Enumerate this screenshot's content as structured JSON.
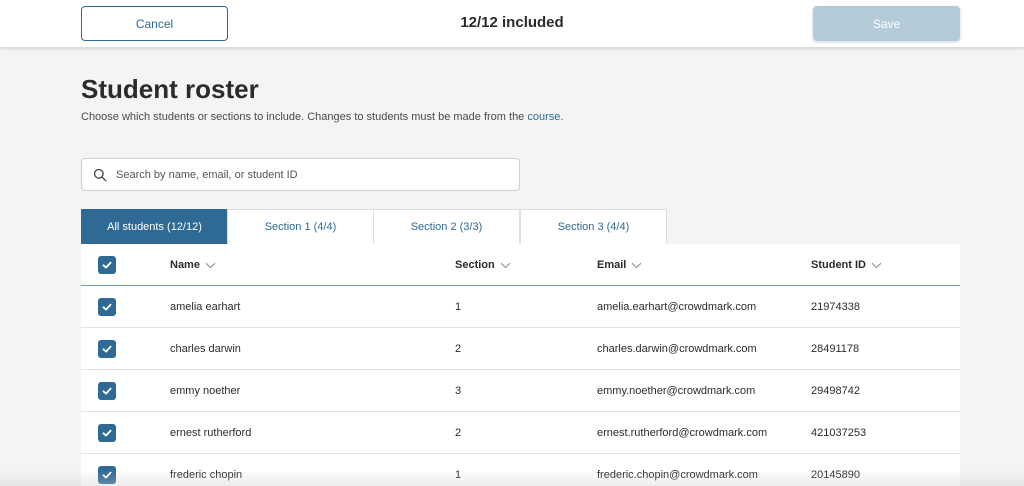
{
  "header": {
    "cancel_label": "Cancel",
    "included_text": "12/12 included",
    "save_label": "Save"
  },
  "page": {
    "title": "Student roster",
    "subtitle_text": "Choose which students or sections to include. Changes to students must be made from the ",
    "subtitle_link": "course",
    "subtitle_end": "."
  },
  "search": {
    "placeholder": "Search by name, email, or student ID",
    "value": ""
  },
  "tabs": [
    {
      "label": "All students (12/12)",
      "active": true
    },
    {
      "label": "Section 1 (4/4)",
      "active": false
    },
    {
      "label": "Section 2 (3/3)",
      "active": false
    },
    {
      "label": "Section 3 (4/4)",
      "active": false
    }
  ],
  "table": {
    "columns": [
      "Name",
      "Section",
      "Email",
      "Student ID"
    ],
    "select_all_checked": true,
    "rows": [
      {
        "name": "amelia earhart",
        "section": "1",
        "email": "amelia.earhart@crowdmark.com",
        "student_id": "21974338",
        "checked": true
      },
      {
        "name": "charles darwin",
        "section": "2",
        "email": "charles.darwin@crowdmark.com",
        "student_id": "28491178",
        "checked": true
      },
      {
        "name": "emmy noether",
        "section": "3",
        "email": "emmy.noether@crowdmark.com",
        "student_id": "29498742",
        "checked": true
      },
      {
        "name": "ernest rutherford",
        "section": "2",
        "email": "ernest.rutherford@crowdmark.com",
        "student_id": "421037253",
        "checked": true
      },
      {
        "name": "frederic chopin",
        "section": "1",
        "email": "frederic.chopin@crowdmark.com",
        "student_id": "20145890",
        "checked": true
      }
    ]
  },
  "colors": {
    "accent": "#2e6a94",
    "save_disabled": "#b4cbd9",
    "background": "#f4f4f4"
  },
  "icons": {
    "search": "search-icon",
    "sort": "chevron-down-icon",
    "check": "check-icon"
  }
}
